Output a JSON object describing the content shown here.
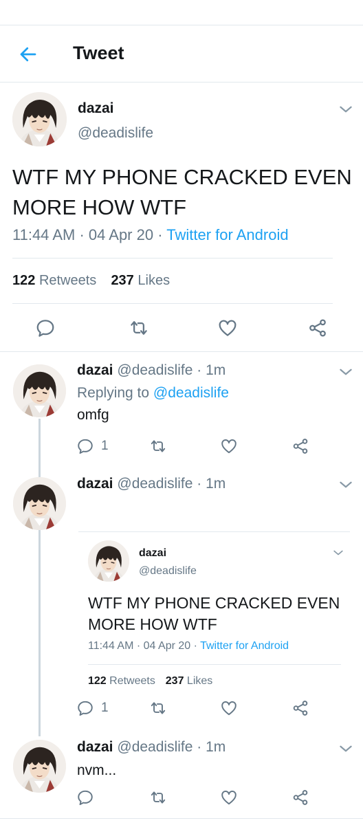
{
  "header": {
    "title": "Tweet"
  },
  "main_tweet": {
    "name": "dazai",
    "handle": "@deadislife",
    "text_line1": "WTF MY PHONE CRACKED EVEN",
    "text_line2": "MORE HOW WTF",
    "time": "11:44 AM",
    "sep1": "·",
    "date": "04 Apr 20",
    "sep2": "·",
    "source": "Twitter for Android",
    "retweets_count": "122",
    "retweets_label": "Retweets",
    "likes_count": "237",
    "likes_label": "Likes"
  },
  "replies": [
    {
      "name": "dazai",
      "handle": "@deadislife",
      "sep": "·",
      "age": "1m",
      "replying_label": "Replying to",
      "replying_to": "@deadislife",
      "text": "omfg",
      "reply_count": "1"
    },
    {
      "name": "dazai",
      "handle": "@deadislife",
      "sep": "·",
      "age": "1m",
      "reply_count": "1",
      "quoted": {
        "name": "dazai",
        "handle": "@deadislife",
        "text_line1": "WTF MY PHONE CRACKED EVEN",
        "text_line2": "MORE HOW WTF",
        "time": "11:44 AM",
        "sep1": "·",
        "date": "04 Apr 20",
        "sep2": "·",
        "source": "Twitter for Android",
        "retweets_count": "122",
        "retweets_label": "Retweets",
        "likes_count": "237",
        "likes_label": "Likes"
      }
    },
    {
      "name": "dazai",
      "handle": "@deadislife",
      "sep": "·",
      "age": "1m",
      "text": "nvm..."
    }
  ],
  "icons": {
    "back": "arrow-left-icon",
    "chevron": "chevron-down-icon",
    "reply": "speech-bubble-icon",
    "retweet": "retweet-icon",
    "like": "heart-icon",
    "share": "share-icon"
  },
  "colors": {
    "accent": "#1da1f2",
    "text": "#14171a",
    "muted": "#657786",
    "divider": "#e1e8ed",
    "thread_line": "#ccd6dd"
  }
}
